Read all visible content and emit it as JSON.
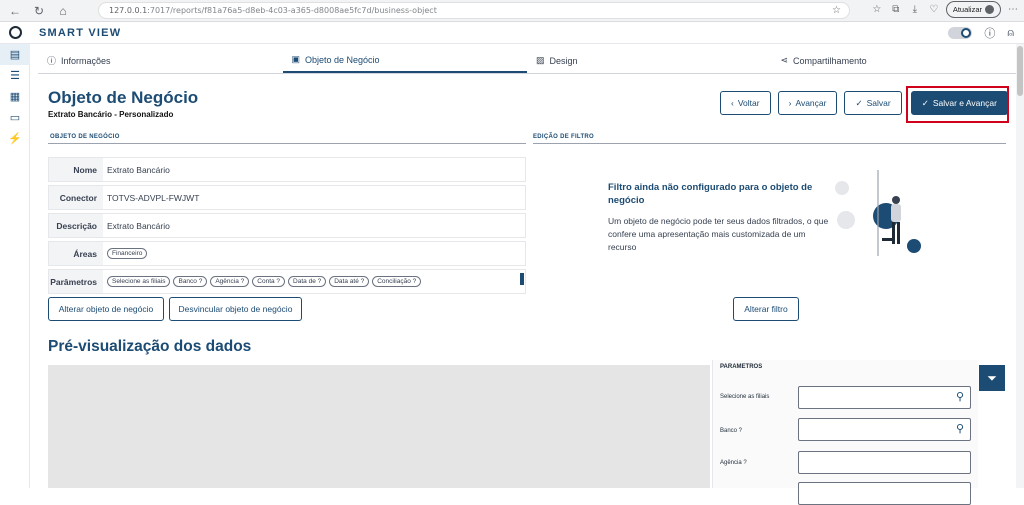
{
  "browser": {
    "url_host": "127.0.0.1",
    "url_path": ":7017/reports/f81a76a5-d8eb-4c03-a365-d8008ae5fc7d/business-object",
    "update_label": "Atualizar"
  },
  "app": {
    "title": "SMART VIEW"
  },
  "tabs": [
    {
      "label": "Informações",
      "icon": "info-icon"
    },
    {
      "label": "Objeto de Negócio",
      "icon": "briefcase-icon"
    },
    {
      "label": "Design",
      "icon": "image-icon"
    },
    {
      "label": "Compartilhamento",
      "icon": "share-icon"
    }
  ],
  "header": {
    "title": "Objeto de Negócio",
    "subtitle": "Extrato Bancário - Personalizado"
  },
  "actions": {
    "back": "Voltar",
    "forward": "Avançar",
    "save": "Salvar",
    "save_forward": "Salvar e Avançar"
  },
  "business_object": {
    "section_title": "OBJETO DE NEGÓCIO",
    "fields": {
      "name_label": "Nome",
      "name_value": "Extrato Bancário",
      "connector_label": "Conector",
      "connector_value": "TOTVS-ADVPL-FWJWT",
      "desc_label": "Descrição",
      "desc_value": "Extrato Bancário",
      "areas_label": "Áreas",
      "areas_chip": "Financeiro",
      "params_label": "Parâmetros"
    },
    "params_chips": [
      "Selecione as filiais",
      "Banco ?",
      "Agência ?",
      "Conta ?",
      "Data de ?",
      "Data até ?",
      "Conciliação ?"
    ],
    "change_button": "Alterar objeto de negócio",
    "unlink_button": "Desvincular objeto de negócio"
  },
  "filter": {
    "section_title": "EDIÇÃO DE FILTRO",
    "title": "Filtro ainda não configurado para o objeto de negócio",
    "description": "Um objeto de negócio pode ter seus dados filtrados, o que confere uma apresentação mais customizada de um recurso",
    "change_button": "Alterar filtro"
  },
  "preview": {
    "title": "Pré-visualização dos dados",
    "params_title": "PARAMETROS",
    "param_labels": [
      "Selecione as filiais",
      "Banco ?",
      "Agência ?"
    ]
  },
  "colors": {
    "primary": "#1c4b73",
    "highlight": "#d0021b"
  }
}
